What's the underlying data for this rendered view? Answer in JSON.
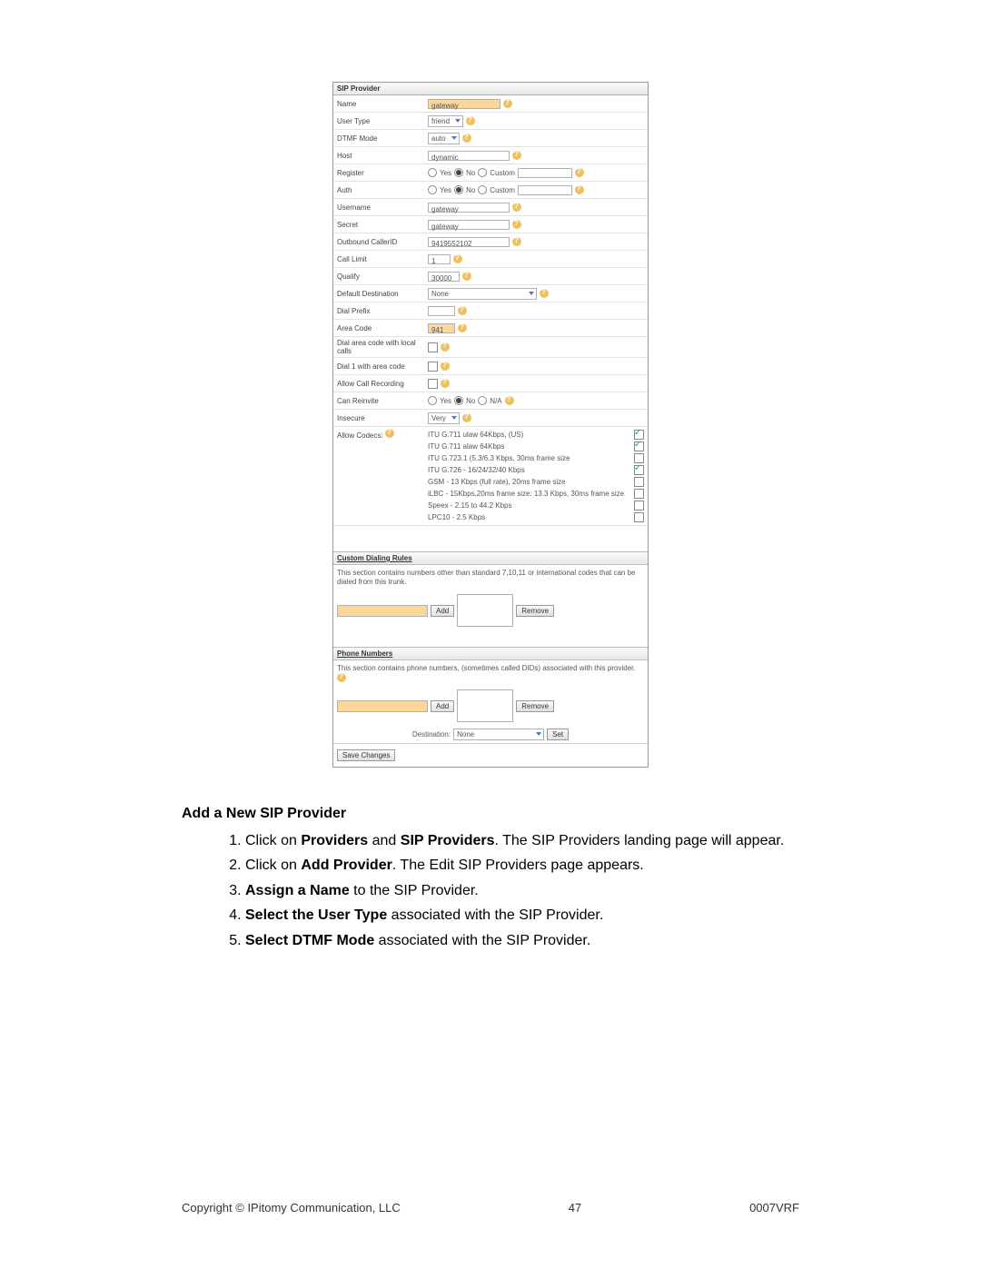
{
  "screenshot": {
    "title": "SIP Provider",
    "fields": {
      "name": {
        "label": "Name",
        "value": "gateway"
      },
      "user_type": {
        "label": "User Type",
        "value": "friend"
      },
      "dtmf_mode": {
        "label": "DTMF Mode",
        "value": "auto"
      },
      "host": {
        "label": "Host",
        "value": "dynamic"
      },
      "register": {
        "label": "Register",
        "yes": "Yes",
        "no": "No",
        "custom": "Custom",
        "value": ""
      },
      "auth": {
        "label": "Auth",
        "yes": "Yes",
        "no": "No",
        "custom": "Custom",
        "value": ""
      },
      "username": {
        "label": "Username",
        "value": "gateway"
      },
      "secret": {
        "label": "Secret",
        "value": "gateway"
      },
      "outbound_cid": {
        "label": "Outbound CallerID",
        "value": "9419552102"
      },
      "call_limit": {
        "label": "Call Limit",
        "value": "1"
      },
      "qualify": {
        "label": "Qualify",
        "value": "30000"
      },
      "default_dest": {
        "label": "Default Destination",
        "value": "None"
      },
      "dial_prefix": {
        "label": "Dial Prefix",
        "value": ""
      },
      "area_code": {
        "label": "Area Code",
        "value": "941"
      },
      "dial_ac_local": {
        "label": "Dial area code with local calls"
      },
      "dial_1_ac": {
        "label": "Dial 1 with area code"
      },
      "allow_rec": {
        "label": "Allow Call Recording"
      },
      "can_reinvite": {
        "label": "Can Reinvite",
        "yes": "Yes",
        "no": "No",
        "na": "N/A"
      },
      "insecure": {
        "label": "Insecure",
        "value": "Very"
      },
      "allow_codecs": {
        "label": "Allow Codecs:"
      }
    },
    "codecs": [
      {
        "label": "ITU G.711 ulaw 64Kbps, (US)",
        "checked": true
      },
      {
        "label": "ITU G.711 alaw 64Kbps",
        "checked": true
      },
      {
        "label": "ITU G.723.1\n(5.3/6.3 Kbps, 30ms frame size",
        "checked": false
      },
      {
        "label": "ITU G.726 - 16/24/32/40 Kbps",
        "checked": true
      },
      {
        "label": "GSM - 13 Kbps (full rate), 20ms frame size",
        "checked": false
      },
      {
        "label": "iLBC - 15Kbps,20ms frame size: 13.3 Kbps, 30ms frame size",
        "checked": false
      },
      {
        "label": "Speex - 2.15 to 44.2 Kbps",
        "checked": false
      },
      {
        "label": "LPC10 - 2.5 Kbps",
        "checked": false
      }
    ],
    "custom_rules": {
      "title": "Custom Dialing Rules",
      "desc": "This section contains numbers other than standard 7,10,11 or international codes that can be dialed from this trunk.",
      "add": "Add",
      "remove": "Remove",
      "value": ""
    },
    "phone_numbers": {
      "title": "Phone Numbers",
      "desc": "This section contains phone numbers, (sometimes called DIDs) associated with this provider.",
      "add": "Add",
      "remove": "Remove",
      "value": "",
      "dest_label": "Destination:",
      "dest_value": "None",
      "set": "Set"
    },
    "save": "Save Changes"
  },
  "instructions": {
    "heading": "Add a New SIP Provider",
    "items": [
      {
        "pre": "Click on ",
        "b1": "Providers",
        "mid": " and ",
        "b2": "SIP Providers",
        "post": ". The SIP Providers landing page will appear."
      },
      {
        "pre": "Click on ",
        "b1": "Add Provider",
        "post": ". The Edit SIP Providers page appears."
      },
      {
        "b1": "Assign a Name",
        "post": " to the SIP Provider."
      },
      {
        "b1": "Select the User Type",
        "post": " associated with the SIP Provider."
      },
      {
        "b1": "Select DTMF Mode",
        "post": " associated with the SIP Provider."
      }
    ]
  },
  "footer": {
    "left": "Copyright © IPitomy Communication, LLC",
    "center": "47",
    "right": "0007VRF"
  }
}
